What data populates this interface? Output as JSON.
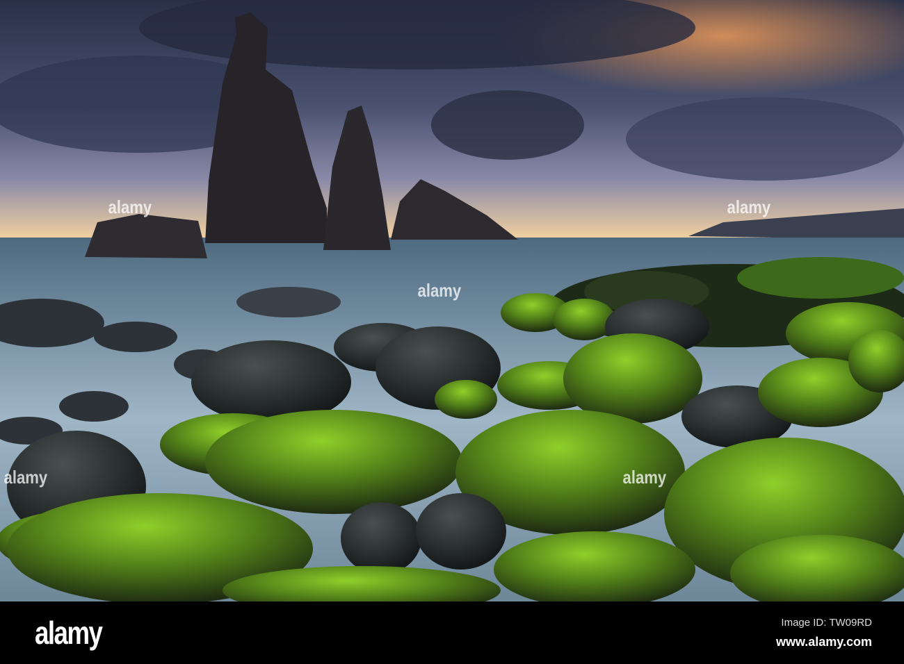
{
  "photo": {
    "subject": "sea-stacks-mossy-boulders",
    "watermark_text": "alamy"
  },
  "footer": {
    "logo": "alamy",
    "image_id": "Image ID: TW09RD",
    "website": "www.alamy.com"
  },
  "colors": {
    "moss": "#7fc21d",
    "sky_dark": "#2f3650",
    "sunset": "#f7a05a"
  }
}
